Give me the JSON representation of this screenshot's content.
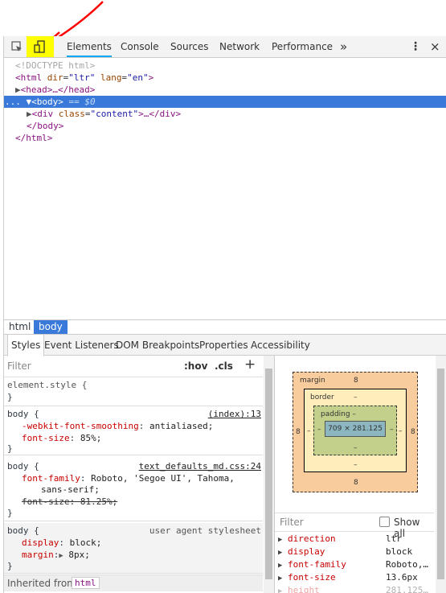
{
  "toolbar": {
    "tabs": [
      "Elements",
      "Console",
      "Sources",
      "Network",
      "Performance"
    ],
    "overflow": "»",
    "more_menu": "⋮",
    "close": "×"
  },
  "dom": {
    "doctype": "<!DOCTYPE html>",
    "html_open_tag": "html",
    "html_attr1_name": "dir",
    "html_attr1_value": "\"ltr\"",
    "html_attr2_name": "lang",
    "html_attr2_value": "\"en\"",
    "head": "<head>…</head>",
    "body_tag": "<body>",
    "body_marker": "== $0",
    "div_tag": "div",
    "div_attr_name": "class",
    "div_attr_value": "\"content\"",
    "div_rest": ">…</div>",
    "body_close": "</body>",
    "html_close": "</html>",
    "ellipsis": "..."
  },
  "breadcrumbs": [
    "html",
    "body"
  ],
  "subtabs": [
    "Styles",
    "Event Listeners",
    "DOM Breakpoints",
    "Properties",
    "Accessibility"
  ],
  "styles": {
    "filter_placeholder": "Filter",
    "hov": ":hov",
    "cls": ".cls",
    "plus": "+",
    "element_style": "element.style {",
    "close_brace": "}",
    "rule1": {
      "selector": "body {",
      "source": "(index):13",
      "props": [
        {
          "name": "-webkit-font-smoothing",
          "value": "antialiased;"
        },
        {
          "name": "font-size",
          "value": "85%;"
        }
      ]
    },
    "rule2": {
      "selector": "body {",
      "source": "text_defaults_md.css:24",
      "font_family_name": "font-family",
      "font_family_value": "Roboto, 'Segoe UI', Tahoma,",
      "font_family_cont": "sans-serif;",
      "struck": "font-size: 81.25%;"
    },
    "rule3": {
      "selector": "body {",
      "source": "user agent stylesheet",
      "props": [
        {
          "name": "display",
          "value": "block;"
        },
        {
          "name": "margin",
          "value": "8px;"
        }
      ]
    },
    "inherited_label": "Inherited from",
    "inherited_tag": "html"
  },
  "box_model": {
    "margin_label": "margin",
    "margin_top": "8",
    "margin_bottom": "8",
    "margin_left": "8",
    "margin_right": "8",
    "border_label": "border",
    "border_top": "–",
    "border_bottom": "–",
    "border_left": "–",
    "border_right": "–",
    "padding_label": "padding –",
    "padding_bottom": "–",
    "padding_left": "–",
    "padding_right": "–",
    "content": "709 × 281.125"
  },
  "computed": {
    "filter_placeholder": "Filter",
    "show_all": "Show all",
    "rows": [
      {
        "name": "direction",
        "value": "ltr"
      },
      {
        "name": "display",
        "value": "block"
      },
      {
        "name": "font-family",
        "value": "Roboto,…"
      },
      {
        "name": "font-size",
        "value": "13.6px"
      },
      {
        "name": "height",
        "value": "281.125…"
      }
    ]
  },
  "colors": {
    "accent": "#03a9f4",
    "selection": "#3879d9",
    "highlight": "#ffff00",
    "arrow": "#ff0000",
    "margin": "#f9cc9d",
    "border": "#ffeebc",
    "padding": "#c3d08b",
    "content": "#8cb6c0"
  }
}
